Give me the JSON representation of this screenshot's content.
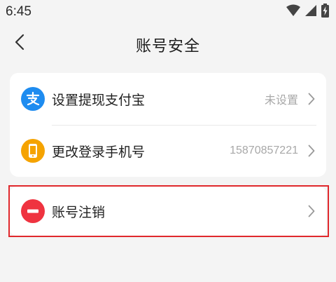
{
  "status_bar": {
    "time": "6:45",
    "icons": [
      "wifi-icon",
      "signal-icon",
      "battery-charging-icon"
    ]
  },
  "header": {
    "title": "账号安全",
    "back_icon": "chevron-left-icon"
  },
  "settings": {
    "items": [
      {
        "label": "设置提现支付宝",
        "value": "未设置",
        "icon": "alipay-icon",
        "icon_color": "#1e8cf0"
      },
      {
        "label": "更改登录手机号",
        "value": "15870857221",
        "icon": "phone-icon",
        "icon_color": "#f5a300"
      }
    ]
  },
  "deregister": {
    "label": "账号注销",
    "icon": "minus-circle-icon",
    "icon_color": "#ef3340",
    "highlight_color": "#e0282c"
  }
}
